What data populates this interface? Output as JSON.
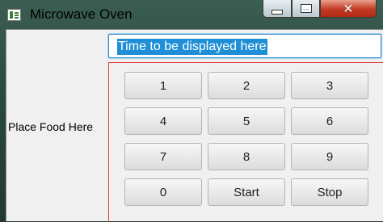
{
  "window": {
    "title": "Microwave Oven",
    "close_glyph": "✕"
  },
  "main": {
    "food_label": "Place Food Here",
    "time_field_value": "Time to be displayed here",
    "keypad": [
      [
        "1",
        "2",
        "3"
      ],
      [
        "4",
        "5",
        "6"
      ],
      [
        "7",
        "8",
        "9"
      ],
      [
        "0",
        "Start",
        "Stop"
      ]
    ]
  },
  "icons": {
    "app": "microwave-app-icon",
    "minimize": "minimize-icon",
    "maximize": "maximize-icon",
    "close": "close-icon"
  },
  "colors": {
    "selection": "#1e8fd6",
    "keypad_border": "#e03a3a",
    "close_button": "#c23a23"
  }
}
